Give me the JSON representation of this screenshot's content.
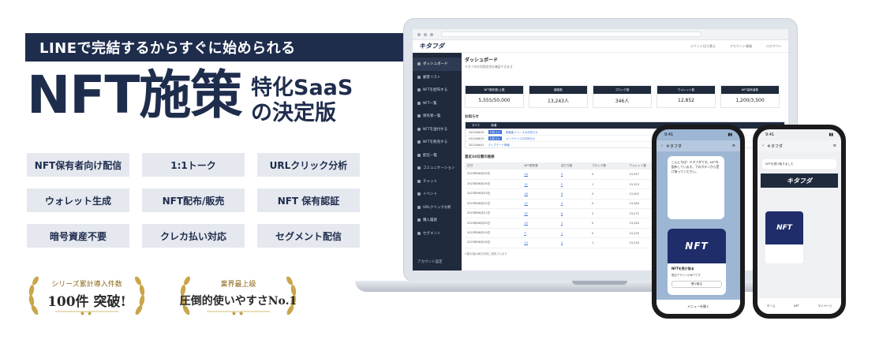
{
  "headline": {
    "banner": "LINEで完結するからすぐに始められる",
    "main": "NFT施策",
    "sub_line1": "特化SaaS",
    "sub_line2": "の決定版"
  },
  "features": [
    "NFT保有者向け配信",
    "1:1トーク",
    "URLクリック分析",
    "ウォレット生成",
    "NFT配布/販売",
    "NFT 保有認証",
    "暗号資産不要",
    "クレカ払い対応",
    "セグメント配信"
  ],
  "awards": [
    {
      "small": "シリーズ累計導入件数",
      "big": "100件 突破!",
      "stars": "★★"
    },
    {
      "small": "業界最上級",
      "big": "圧倒的使いやすさNo.1",
      "stars": "★★"
    }
  ],
  "app": {
    "logo": "キタフダ",
    "header_links": [
      "テナント切り替え",
      "アカウント情報",
      "ログアウト"
    ],
    "sidebar": [
      "ダッシュボード",
      "顧客リスト",
      "NFTを配布する",
      "NFT一覧",
      "保有者一覧",
      "NFTを送付する",
      "NFTを販売する",
      "配信一覧",
      "コミュニケーション",
      "チャット",
      "イベント",
      "URLクリック分析",
      "購入履歴",
      "セグメント"
    ],
    "sidebar_bottom": "アカウント設定",
    "page_title": "ダッシュボード",
    "page_desc": "キタフダの利用状況を確認できます",
    "stats": [
      {
        "label": "NFT配布数/上限",
        "value": "5,555/50,000"
      },
      {
        "label": "顧客数",
        "value": "13,243人"
      },
      {
        "label": "ブロック数",
        "value": "346人"
      },
      {
        "label": "ウォレット数",
        "value": "12,852"
      },
      {
        "label": "NFT保有者数",
        "value": "1,200/3,500"
      }
    ],
    "notice_title": "お知らせ",
    "notice_tabs": [
      "すべて",
      "新着"
    ],
    "notices": [
      {
        "date": "2023/06/30",
        "tag": "お知らせ",
        "text": "新機能リリースのお知らせ"
      },
      {
        "date": "2023/06/15",
        "tag": "お知らせ",
        "text": "メンテナンスのお知らせ"
      },
      {
        "date": "2023/06/01",
        "tag": "",
        "text": "アップデート情報"
      }
    ],
    "table_title": "直近10日間の推移",
    "table_headers": [
      "日付",
      "NFT配布数",
      "友だち数",
      "ブロック数",
      "ウォレット数",
      "保有者数"
    ],
    "table_rows": [
      [
        "2023年06月25日",
        "24",
        "4",
        "0",
        "13,347",
        "12,0"
      ],
      [
        "2023年06月24日",
        "21",
        "5",
        "1",
        "13,323",
        "12,0"
      ],
      [
        "2023年06月23日",
        "18",
        "6",
        "0",
        "13,302",
        "12,0"
      ],
      [
        "2023年06月22日",
        "12",
        "3",
        "0",
        "13,284",
        "12,0"
      ],
      [
        "2023年06月21日",
        "32",
        "8",
        "2",
        "13,272",
        "12,0"
      ],
      [
        "2023年06月20日",
        "15",
        "2",
        "0",
        "13,240",
        "12,0"
      ],
      [
        "2023年06月19日",
        "9",
        "1",
        "0",
        "13,225",
        "12,0"
      ],
      [
        "2023年06月18日",
        "14",
        "4",
        "1",
        "13,216",
        "12,0"
      ]
    ],
    "footnote": "※集計値は毎日深夜に更新されます"
  },
  "phone1": {
    "time": "9:41",
    "title": "キタフダ",
    "message": "こんにちは！キタフダです。NFTを配布しています。下のボタンから受け取ってください。",
    "card_image": "NFT",
    "card_title": "NFTを受け取る",
    "card_desc": "限定デザインのNFTです",
    "card_button": "受け取る",
    "bottom": "メニューを開く"
  },
  "phone2": {
    "time": "9:41",
    "title": "キタフダ",
    "message": "NFTを受け取りました",
    "banner": "キタフダ",
    "card_image": "NFT",
    "tabs": [
      "ホーム",
      "NFT",
      "マイページ"
    ]
  }
}
